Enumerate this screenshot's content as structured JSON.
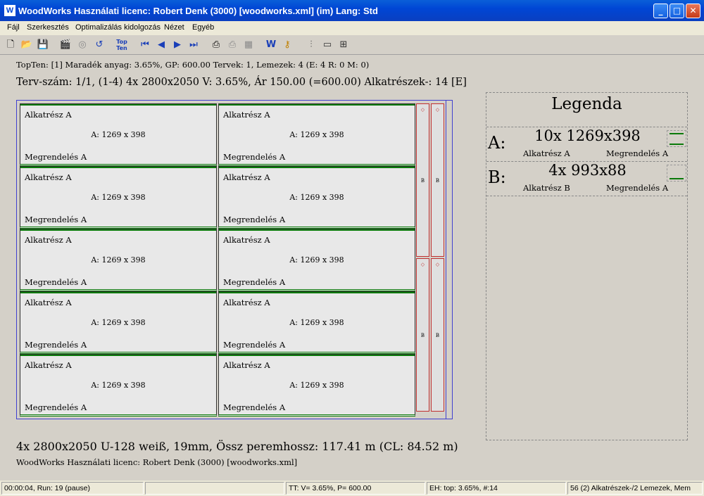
{
  "window": {
    "title": "WoodWorks Használati licenc:  Robert Denk (3000) [woodworks.xml] (im) Lang: Std"
  },
  "menu": [
    "Fájl",
    "Szerkesztés",
    "Optimalizálás kidolgozás",
    "Nézet",
    "Egyéb"
  ],
  "toolbar": {
    "topten_line1": "Top",
    "topten_line2": "Ten",
    "icons": [
      "new-file-icon",
      "open-folder-icon",
      "save-icon",
      "clapper-icon",
      "target-icon",
      "refresh-icon",
      "topten-icon",
      "first-icon",
      "prev-icon",
      "next-icon",
      "last-icon",
      "print-icon",
      "print-preview-icon",
      "grid-icon",
      "woodworks-icon",
      "key-icon",
      "mixer-icon",
      "window-icon",
      "tile-icon"
    ]
  },
  "info": {
    "line1": "TopTen: [1] Maradék anyag:  3.65%, GP: 600.00 Tervek: 1, Lemezek: 4 (E: 4 R: 0 M: 0)",
    "line2": "Terv-szám: 1/1, (1-4) 4x 2800x2050 V:  3.65%, Ár 150.00 (=600.00) Alkatrészek-: 14    [E]"
  },
  "board": {
    "parts": [
      {
        "name": "Alkatrész A",
        "dim": "A: 1269 x 398",
        "order": "Megrendelés A"
      },
      {
        "name": "Alkatrész A",
        "dim": "A: 1269 x 398",
        "order": "Megrendelés A"
      },
      {
        "name": "Alkatrész A",
        "dim": "A: 1269 x 398",
        "order": "Megrendelés A"
      },
      {
        "name": "Alkatrész A",
        "dim": "A: 1269 x 398",
        "order": "Megrendelés A"
      },
      {
        "name": "Alkatrész A",
        "dim": "A: 1269 x 398",
        "order": "Megrendelés A"
      },
      {
        "name": "Alkatrész A",
        "dim": "A: 1269 x 398",
        "order": "Megrendelés A"
      },
      {
        "name": "Alkatrész A",
        "dim": "A: 1269 x 398",
        "order": "Megrendelés A"
      },
      {
        "name": "Alkatrész A",
        "dim": "A: 1269 x 398",
        "order": "Megrendelés A"
      },
      {
        "name": "Alkatrész A",
        "dim": "A: 1269 x 398",
        "order": "Megrendelés A"
      },
      {
        "name": "Alkatrész A",
        "dim": "A: 1269 x 398",
        "order": "Megrendelés A"
      }
    ],
    "strip_label": "B",
    "strip_mark": "◇"
  },
  "legend": {
    "title": "Legenda",
    "rows": [
      {
        "letter": "A:",
        "qty": "10x 1269x398",
        "part": "Alkatrész A",
        "order": "Megrendelés A"
      },
      {
        "letter": "B:",
        "qty": "4x 993x88",
        "part": "Alkatrész B",
        "order": "Megrendelés A"
      }
    ]
  },
  "summary": "4x 2800x2050 U-128 weiß, 19mm, Össz peremhossz: 117.41 m (CL: 84.52 m)",
  "license": "WoodWorks Használati licenc:  Robert Denk (3000) [woodworks.xml]",
  "status": [
    "00:00:04, Run: 19 (pause)",
    "",
    "TT: V= 3.65%, P= 600.00",
    "EH: top: 3.65%,  #:14",
    "56 (2) Alkatrészek-/2 Lemezek, Mem"
  ],
  "colors": {
    "accent": "#0046d5",
    "edge": "#0a7a0a",
    "strip": "#c03030",
    "boardline": "#4040d0"
  }
}
